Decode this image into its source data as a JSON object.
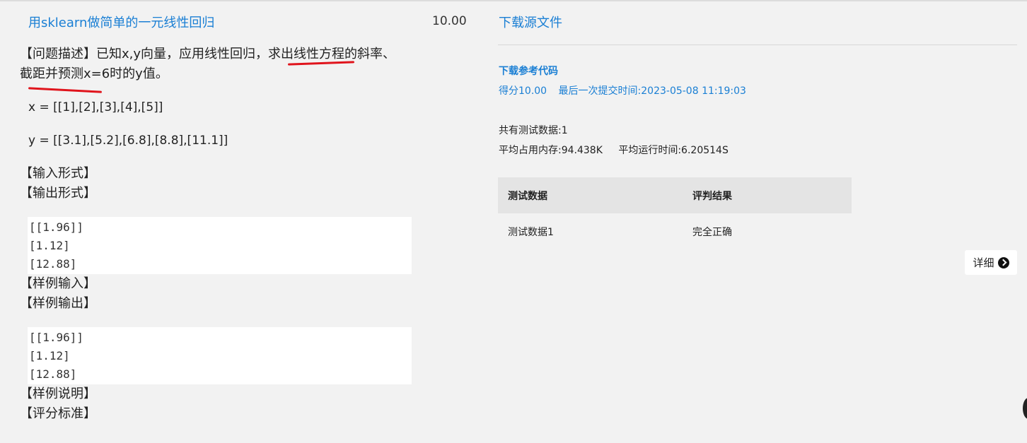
{
  "problem": {
    "title": "用sklearn做简单的一元线性回归",
    "score": "10.00",
    "description_part1": "【问题描述】已知x,y向量，应用线性回归，",
    "description_underlined": "求出线性方程",
    "description_part2": "的斜率、截距并预测x=6时的y值。",
    "x_vector": "x = [[1],[2],[3],[4],[5]]",
    "y_vector": "y = [[3.1],[5.2],[6.8],[8.8],[11.1]]",
    "input_format_label": "【输入形式】",
    "output_format_label": "【输出形式】",
    "output_code": [
      "[[1.96]]",
      "[1.12]",
      "[12.88]"
    ],
    "sample_input_label": "【样例输入】",
    "sample_output_label": "【样例输出】",
    "sample_output_code": [
      "[[1.96]]",
      "[1.12]",
      "[12.88]"
    ],
    "sample_explain_label": "【样例说明】",
    "scoring_label": "【评分标准】"
  },
  "submission": {
    "download_source": "下载源文件",
    "download_reference": "下载参考代码",
    "score_text": "得分10.00",
    "last_submit": "最后一次提交时间:2023-05-08 11:19:03",
    "test_count": "共有测试数据:1",
    "avg_memory": "平均占用内存:94.438K",
    "avg_runtime": "平均运行时间:6.20514S",
    "table_headers": [
      "测试数据",
      "评判结果"
    ],
    "table_rows": [
      [
        "测试数据1",
        "完全正确"
      ]
    ],
    "detail_button": "详细"
  },
  "colors": {
    "link": "#1a7fd4",
    "annotation_red": "#e0141c",
    "background": "#f2f2f2"
  }
}
